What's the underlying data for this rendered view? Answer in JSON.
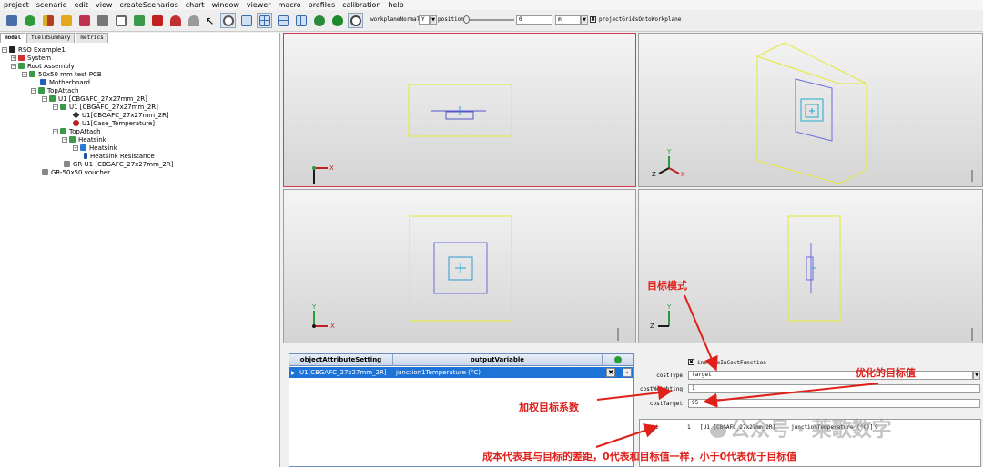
{
  "menu": [
    "project",
    "scenario",
    "edit",
    "view",
    "createScenarios",
    "chart",
    "window",
    "viewer",
    "macro",
    "profiles",
    "calibration",
    "help"
  ],
  "toolbar": {
    "workplane_label": "workplaneNormal",
    "workplane_value": "Y",
    "position_label": "position",
    "position_value": "0",
    "unit_value": "m",
    "project_grids_label": "projectGridsOntoWorkplane"
  },
  "tabs": [
    "model",
    "fieldSummary",
    "metrics"
  ],
  "tree": [
    {
      "label": "RSO Example1"
    },
    {
      "label": "System"
    },
    {
      "label": "Root Assembly"
    },
    {
      "label": "50x50 mm test PCB"
    },
    {
      "label": "Motherboard"
    },
    {
      "label": "TopAttach"
    },
    {
      "label": "U1 [CBGAFC_27x27mm_2R]"
    },
    {
      "label": "U1 [CBGAFC_27x27mm_2R]"
    },
    {
      "label": "U1[CBGAFC_27x27mm_2R]"
    },
    {
      "label": "U1[Case_Temperature]"
    },
    {
      "label": "TopAttach"
    },
    {
      "label": "Heatsink"
    },
    {
      "label": "Heatsink"
    },
    {
      "label": "Heatsink Resistance"
    },
    {
      "label": "GR-U1 [CBGAFC_27x27mm_2R]"
    },
    {
      "label": "GR-50x50 voucher"
    }
  ],
  "axes": {
    "y": "Y",
    "x": "X",
    "z": "Z"
  },
  "grid": {
    "headers": [
      "objectAttributeSetting",
      "outputVariable"
    ],
    "row": {
      "object": "U1[CBGAFC_27x27mm_2R]",
      "output": "junction1Temperature (°C)"
    },
    "btn_minus": "-"
  },
  "props": {
    "include_label": "includeInCostFunction",
    "cost_type_label": "costType",
    "cost_type_value": "target",
    "cost_weighting_label": "costWeighting",
    "cost_weighting_value": "1",
    "cost_target_label": "costTarget",
    "cost_target_value": "95",
    "cost_label": "cost",
    "cost_value_1": "1",
    "cost_value_2": "[U1 [CBGAFC_27x27mm_2R]",
    "cost_value_3": "junctionTemperature (°C)]",
    "cost_value_4": "9"
  },
  "annotations": {
    "target_mode": "目标模式",
    "optimized_target": "优化的目标值",
    "weight_coef": "加权目标系数",
    "cost_desc": "成本代表其与目标的差距，0代表和目标值一样，小于0代表优于目标值"
  },
  "watermark": "公众号 · 莱歌数字",
  "colors": {
    "selection": "#1e73d6",
    "annotation": "#e0201a",
    "yellow_box": "#e8e830",
    "blue_box": "#6a6ae0"
  }
}
